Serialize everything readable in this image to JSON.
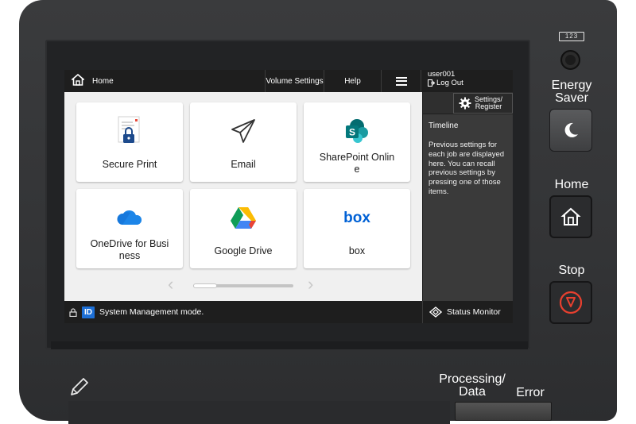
{
  "topbar": {
    "home_label": "Home",
    "volume_label": "Volume Settings",
    "help_label": "Help",
    "user_name": "user001",
    "logout_label": "Log Out"
  },
  "tiles": [
    {
      "label": "Secure Print",
      "icon": "secure-print-icon"
    },
    {
      "label": "Email",
      "icon": "email-icon"
    },
    {
      "label": "SharePoint Onlin\ne",
      "icon": "sharepoint-icon"
    },
    {
      "label": "OneDrive for Busi\nness",
      "icon": "onedrive-icon"
    },
    {
      "label": "Google Drive",
      "icon": "google-drive-icon"
    },
    {
      "label": "box",
      "icon": "box-icon"
    }
  ],
  "side_panel": {
    "settings_label_1": "Settings/",
    "settings_label_2": "Register",
    "timeline_title": "Timeline",
    "timeline_text": "Previous settings for each job are displayed here. You can recall previous settings by pressing one of those items."
  },
  "statusbar": {
    "mode_badge": "ID",
    "mode_text": "System Management mode.",
    "status_monitor_label": "Status Monitor"
  },
  "hardware": {
    "counter_label": "123",
    "energy_saver_1": "Energy",
    "energy_saver_2": "Saver",
    "home_label": "Home",
    "stop_label": "Stop",
    "processing_1": "Processing/",
    "processing_2": "Data",
    "error_label": "Error"
  },
  "colors": {
    "stop_red": "#e8402f",
    "id_blue": "#1d6fd6",
    "sharepoint_teal": "#0b7a75",
    "onedrive_blue": "#1c85e8",
    "box_blue": "#0061d5"
  }
}
